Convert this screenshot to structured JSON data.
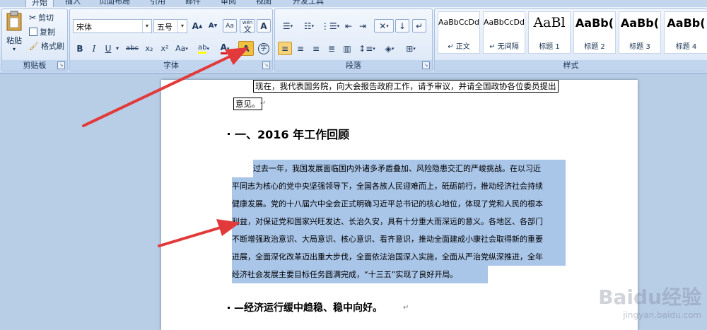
{
  "tabs": [
    "开始",
    "插入",
    "页面布局",
    "引用",
    "邮件",
    "审阅",
    "视图",
    "开发工具"
  ],
  "clipboard": {
    "paste": "粘贴",
    "cut": "剪切",
    "copy": "复制",
    "format_painter": "格式刷",
    "label": "剪贴板"
  },
  "font": {
    "name": "宋体",
    "size": "五号",
    "wen": "wén",
    "label": "字体",
    "b": "B",
    "i": "I",
    "u": "U",
    "abc": "abc",
    "x2": "x₂",
    "x2sup": "x²",
    "aa": "Aa",
    "a": "A"
  },
  "paragraph": {
    "label": "段落"
  },
  "styles": {
    "label": "样式",
    "items": [
      {
        "sample": "AaBbCcDd",
        "name": "↵ 正文"
      },
      {
        "sample": "AaBbCcDd",
        "name": "↵ 无间隔"
      },
      {
        "sample": "AaBl",
        "name": "标题 1"
      },
      {
        "sample": "AaBb(",
        "name": "标题 2"
      },
      {
        "sample": "AaBb(",
        "name": "标题 3"
      },
      {
        "sample": "AaBb(",
        "name": "标题 4"
      }
    ]
  },
  "document": {
    "intro1": "现在，我代表国务院，向大会报告政府工作，请予审议，并请全国政协各位委员提出",
    "intro2": "意见。",
    "heading1": "一、2016 年工作回顾",
    "para_lines": [
      "过去一年，我国发展面临国内外诸多矛盾叠加、风险隐患交汇的严峻挑战。在以习近",
      "平同志为核心的党中央坚强领导下，全国各族人民迎难而上，砥砺前行，推动经济社会持续",
      "健康发展。党的十八届六中全会正式明确习近平总书记的核心地位，体现了党和人民的根本",
      "利益，对保证党和国家兴旺发达、长治久安，具有十分重大而深远的意义。各地区、各部门",
      "不断增强政治意识、大局意识、核心意识、看齐意识，推动全面建成小康社会取得新的重要",
      "进展，全面深化改革迈出重大步伐，全面依法治国深入实施，全面从严治党纵深推进，全年",
      "经济社会发展主要目标任务圆满完成，“十三五”实现了良好开局。"
    ],
    "heading2": "—经济运行缓中趋稳、稳中向好。",
    "para_mark": "↵"
  },
  "watermark": {
    "brand": "Baidu经验",
    "url": "jingyan.baidu.com"
  },
  "colors": {
    "highlight": "#a9c5e8",
    "arrow": "#e23a3a",
    "ribbon": "#dce8f7"
  }
}
